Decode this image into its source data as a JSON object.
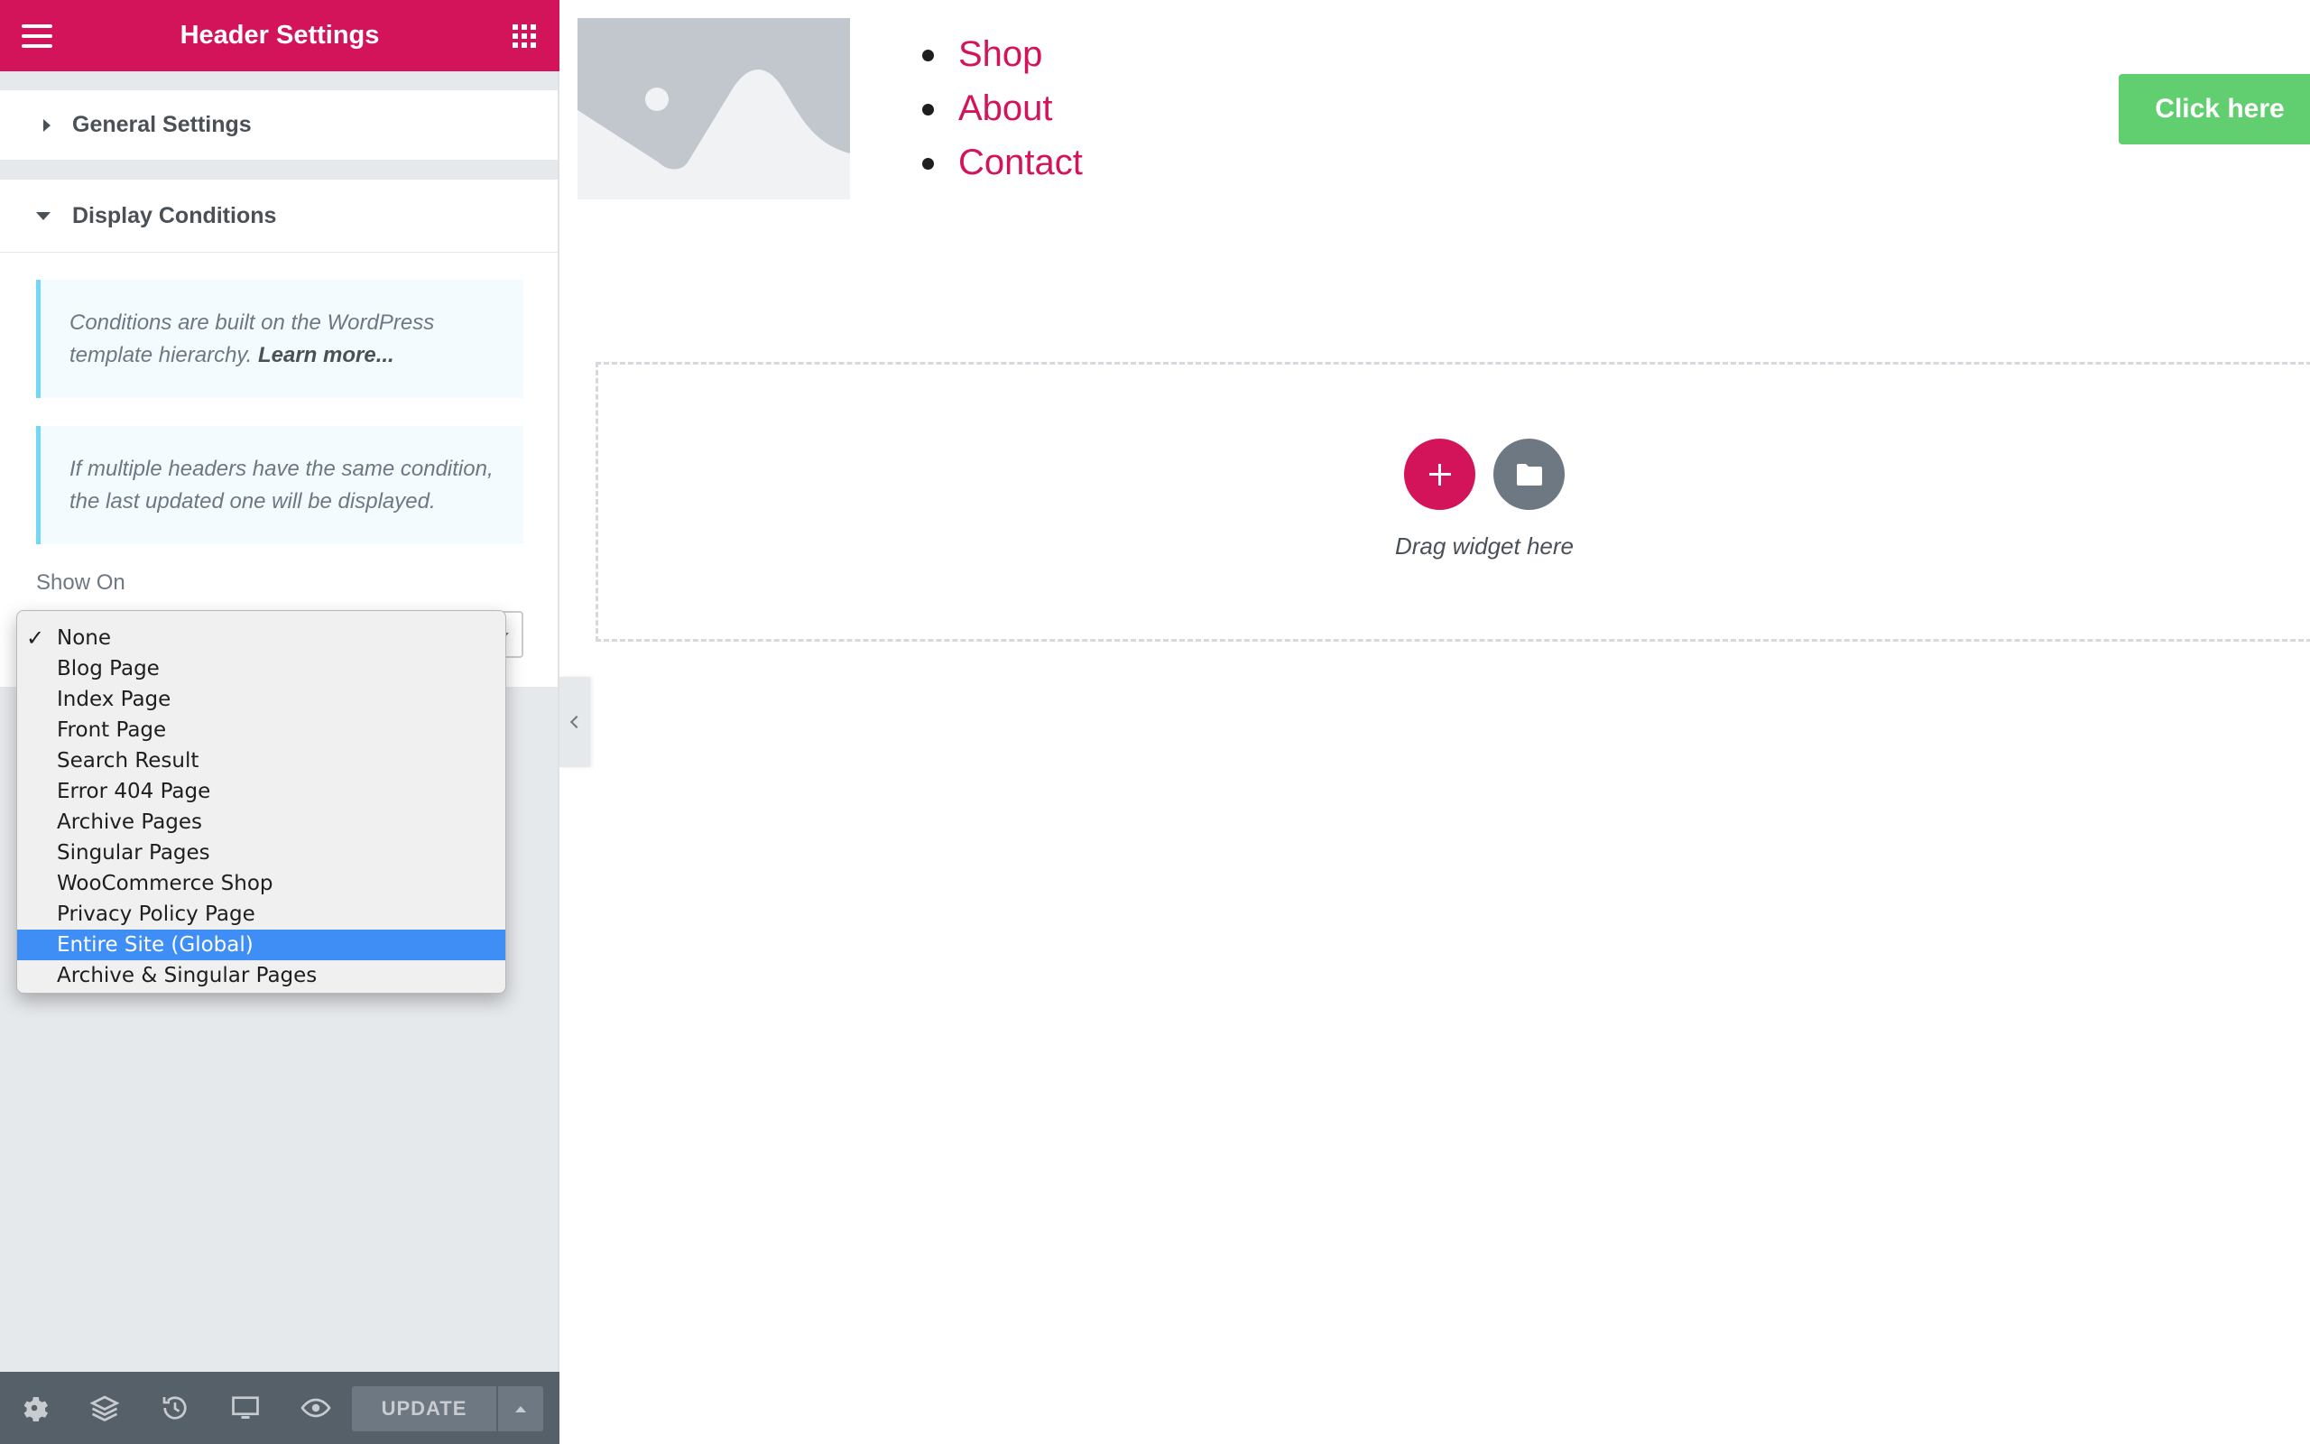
{
  "panel": {
    "title": "Header Settings",
    "icons": {
      "menu": "hamburger-icon",
      "apps": "grid-icon"
    }
  },
  "sections": {
    "general": {
      "label": "General Settings",
      "expanded": false
    },
    "display": {
      "label": "Display Conditions",
      "expanded": true
    }
  },
  "notices": {
    "conditions_text": "Conditions are built on the WordPress template hierarchy.",
    "conditions_link": "Learn more...",
    "multiple_text": "If multiple headers have the same condition, the last updated one will be displayed."
  },
  "show_on": {
    "label": "Show On",
    "current_value": "None",
    "options": [
      "None",
      "Blog Page",
      "Index Page",
      "Front Page",
      "Search Result",
      "Error 404 Page",
      "Archive Pages",
      "Singular Pages",
      "WooCommerce Shop",
      "Privacy Policy Page",
      "Entire Site (Global)",
      "Archive & Singular Pages"
    ],
    "checked_index": 0,
    "highlighted_index": 10
  },
  "footer": {
    "icons": [
      "gear-icon",
      "layers-icon",
      "history-icon",
      "desktop-icon",
      "eye-icon"
    ],
    "update_label": "UPDATE"
  },
  "preview": {
    "nav": [
      "Shop",
      "About",
      "Contact"
    ],
    "cta_label": "Click here",
    "drop_text": "Drag widget here"
  },
  "colors": {
    "brand": "#d3145a",
    "cta": "#61ce70",
    "selection": "#3f8ef5",
    "panel_bg": "#e6e9ec",
    "footer_bg": "#556068",
    "notice_border": "#71d7f7"
  }
}
